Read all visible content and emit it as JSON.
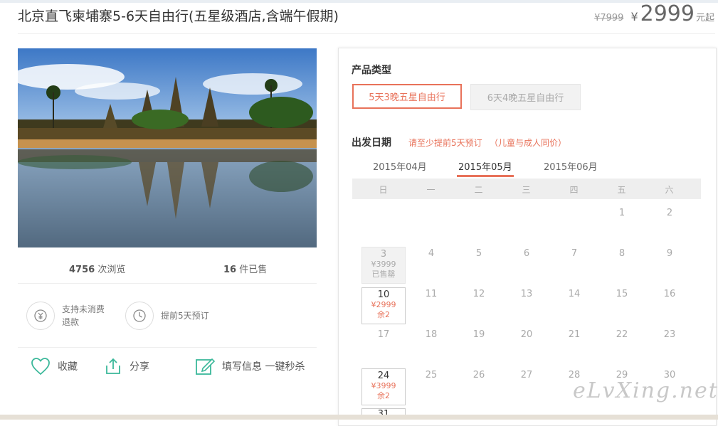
{
  "header": {
    "title": "北京直飞柬埔寨5-6天自由行(五星级酒店,含端午假期)",
    "old_price": "¥7999",
    "currency": "¥",
    "price": "2999",
    "price_suffix": "元起"
  },
  "stats": {
    "views_count": "4756",
    "views_label": "次浏览",
    "sold_count": "16",
    "sold_label": "件已售"
  },
  "features": [
    {
      "icon": "yen-refund-icon",
      "text": "支持未消费退款"
    },
    {
      "icon": "clock-icon",
      "text": "提前5天预订"
    }
  ],
  "actions": {
    "favorite": "收藏",
    "share": "分享",
    "quick_book": "填写信息 一键秒杀"
  },
  "product": {
    "type_label": "产品类型",
    "types": [
      "5天3晚五星自由行",
      "6天4晚五星自由行"
    ],
    "date_label": "出发日期",
    "date_note1": "请至少提前5天预订",
    "date_note2": "（儿童与成人同价）"
  },
  "calendar": {
    "months": [
      "2015年04月",
      "2015年05月",
      "2015年06月"
    ],
    "active_month": "2015年05月",
    "weekdays": [
      "日",
      "一",
      "二",
      "三",
      "四",
      "五",
      "六"
    ],
    "days": [
      "1",
      "2",
      "3",
      "4",
      "5",
      "6",
      "7",
      "8",
      "9",
      "10",
      "11",
      "12",
      "13",
      "14",
      "15",
      "16",
      "17",
      "18",
      "19",
      "20",
      "21",
      "22",
      "23",
      "24",
      "25",
      "26",
      "27",
      "28",
      "29",
      "30",
      "31"
    ],
    "special": {
      "d3": {
        "price": "¥3999",
        "status": "已售罄"
      },
      "d10": {
        "price": "¥2999",
        "status": "余2"
      },
      "d24": {
        "price": "¥3999",
        "status": "余2"
      }
    }
  },
  "watermark": "eLvXing.net",
  "colors": {
    "accent": "#e8725a",
    "green": "#3bb89a"
  }
}
